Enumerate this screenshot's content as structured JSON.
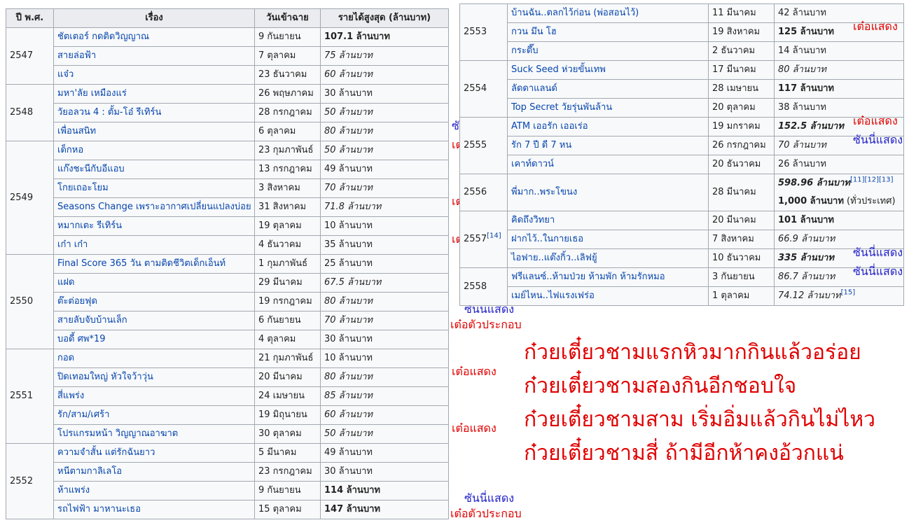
{
  "left_table": {
    "headers": [
      "ปี พ.ศ.",
      "เรื่อง",
      "วันเข้าฉาย",
      "รายได้สูงสุด (ล้านบาท)"
    ],
    "rows": [
      {
        "year": "2547",
        "title": "ชัตเตอร์ กดติดวิญญาณ",
        "date": "9 กันยายน",
        "gross": "107.1 ล้านบาท",
        "style": "big"
      },
      {
        "title": "สายล่อฟ้า",
        "date": "7 ตุลาคม",
        "gross": "75 ล้านบาท",
        "style": "inc"
      },
      {
        "title": "แจ๋ว",
        "date": "23 ธันวาคม",
        "gross": "60 ล้านบาท",
        "style": "inc"
      },
      {
        "year": "2548",
        "title": "มหา'ลัย เหมืองแร่",
        "date": "26 พฤษภาคม",
        "gross": "30 ล้านบาท",
        "style": ""
      },
      {
        "title": "วัยอลวน 4 : ตั้ม-โอ๋ รีเทิร์น",
        "date": "28 กรกฎาคม",
        "gross": "50 ล้านบาท",
        "style": "inc"
      },
      {
        "title": "เพื่อนสนิท",
        "date": "6 ตุลาคม",
        "gross": "80 ล้านบาท",
        "style": "inc",
        "note": "ซันนี่แสดง",
        "note_color": "blue"
      },
      {
        "year": "2549",
        "title": "เด็กหอ",
        "date": "23 กุมภาพันธ์",
        "gross": "50 ล้านบาท",
        "style": "inc",
        "note": "เต๋อตัวประกอบ",
        "note_color": "red"
      },
      {
        "title": "แก๊งชะนีกับอีแอบ",
        "date": "13 กรกฎาคม",
        "gross": "49 ล้านบาท",
        "style": ""
      },
      {
        "title": "โกยเถอะโยม",
        "date": "3 สิงหาคม",
        "gross": "70 ล้านบาท",
        "style": "inc"
      },
      {
        "title": "Seasons Change เพราะอากาศเปลี่ยนแปลงบ่อย",
        "date": "31 สิงหาคม",
        "gross": "71.8 ล้านบาท",
        "style": "inc",
        "note": "เต๋อตัวประกอบ",
        "note_color": "red"
      },
      {
        "title": "หมากเตะ รีเทิร์น",
        "date": "19 ตุลาคม",
        "gross": "10 ล้านบาท",
        "style": ""
      },
      {
        "title": "เก๋า เก๋า",
        "date": "4 ธันวาคม",
        "gross": "35 ล้านบาท",
        "style": "",
        "note": "เต๋อตัวประกอบ",
        "note_color": "red"
      },
      {
        "year": "2550",
        "title": "Final Score 365 วัน ตามติดชีวิตเด็กเอ็นท์",
        "date": "1 กุมภาพันธ์",
        "gross": "25 ล้านบาท",
        "style": ""
      },
      {
        "title": "แฝด",
        "date": "29 มีนาคม",
        "gross": "67.5 ล้านบาท",
        "style": "inc"
      },
      {
        "title": "ต๊ะต่อยฟุด",
        "date": "19 กรกฎาคม",
        "gross": "80 ล้านบาท",
        "style": "inc"
      },
      {
        "title": "สายลับจับบ้านเล็ก",
        "date": "6 กันยายน",
        "gross": "70 ล้านบาท",
        "style": "inc",
        "note": "ซันนี่แสดง",
        "note_color": "blue",
        "note2": "เต๋อตัวประกอบ",
        "note2_color": "red"
      },
      {
        "title": "บอดี้ ศพ*19",
        "date": "4 ตุลาคม",
        "gross": "30 ล้านบาท",
        "style": ""
      },
      {
        "year": "2551",
        "title": "กอด",
        "date": "21 กุมภาพันธ์",
        "gross": "10 ล้านบาท",
        "style": ""
      },
      {
        "title": "ปิดเทอมใหญ่ หัวใจว้าวุ่น",
        "date": "20 มีนาคม",
        "gross": "80 ล้านบาท",
        "style": "inc",
        "note": "เต๋อแสดง",
        "note_color": "red"
      },
      {
        "title": "สี่แพร่ง",
        "date": "24 เมษายน",
        "gross": "85 ล้านบาท",
        "style": "inc"
      },
      {
        "title": "รัก/สาม/เศร้า",
        "date": "19 มิถุนายน",
        "gross": "60 ล้านบาท",
        "style": "inc"
      },
      {
        "title": "โปรแกรมหน้า วิญญาณอาฆาต",
        "date": "30 ตุลาคม",
        "gross": "50 ล้านบาท",
        "style": "inc",
        "note": "เต๋อแสดง",
        "note_color": "red"
      },
      {
        "year": "2552",
        "title": "ความจำสั้น แต่รักฉันยาว",
        "date": "5 มีนาคม",
        "gross": "49 ล้านบาท",
        "style": ""
      },
      {
        "title": "หนีตามกาลิเลโอ",
        "date": "23 กรกฎาคม",
        "gross": "30 ล้านบาท",
        "style": ""
      },
      {
        "title": "ห้าแพร่ง",
        "date": "9 กันยายน",
        "gross": "114 ล้านบาท",
        "style": "big"
      },
      {
        "title": "รถไฟฟ้า มาหานะเธอ",
        "date": "15 ตุลาคม",
        "gross": "147 ล้านบาท",
        "style": "big",
        "note": "ซันนี่แสดง",
        "note_color": "blue",
        "note2": "เต๋อตัวประกอบ",
        "note2_color": "red"
      }
    ]
  },
  "right_table": {
    "rows": [
      {
        "year": "2553",
        "title": "บ้านฉัน..ตลกไว้ก่อน (พ่อสอนไว้)",
        "date": "11 มีนาคม",
        "gross": "42 ล้านบาท",
        "style": ""
      },
      {
        "title": "กวน มึน โฮ",
        "date": "19 สิงหาคม",
        "gross": "125 ล้านบาท",
        "style": "big",
        "note": "เต๋อแสดง",
        "note_color": "red"
      },
      {
        "title": "กระดึ๊บ",
        "date": "2 ธันวาคม",
        "gross": "14 ล้านบาท",
        "style": ""
      },
      {
        "year": "2554",
        "title": "Suck Seed ห่วยขั้นเทพ",
        "date": "17 มีนาคม",
        "gross": "80 ล้านบาท",
        "style": "inc"
      },
      {
        "title": "ลัดดาแลนด์",
        "date": "28 เมษายน",
        "gross": "117 ล้านบาท",
        "style": "big"
      },
      {
        "title": "Top Secret วัยรุ่นพันล้าน",
        "date": "20 ตุลาคม",
        "gross": "38 ล้านบาท",
        "style": ""
      },
      {
        "year": "2555",
        "title": "ATM เออรัก เออเร่อ",
        "date": "19 มกราคม",
        "gross": "152.5 ล้านบาท",
        "style": "bigi",
        "note": "เต๋อแสดง",
        "note_color": "red"
      },
      {
        "title": "รัก 7 ปี ดี 7 หน",
        "date": "26 กรกฎาคม",
        "gross": "70 ล้านบาท",
        "style": "inc",
        "note": "ซันนี่แสดง",
        "note_color": "blue"
      },
      {
        "title": "เคาท์ดาวน์",
        "date": "20 ธันวาคม",
        "gross": "26 ล้านบาท",
        "style": ""
      },
      {
        "year": "2556",
        "title": "พี่มาก..พระโขนง",
        "date": "28 มีนาคม",
        "gross": "598.96 ล้านบาท",
        "gross_refs": "[11][12][13]",
        "gross2": "1,000 ล้านบาท",
        "gross2_suffix": " (ทั่วประเทศ)",
        "style": "bigi"
      },
      {
        "year": "2557",
        "year_ref": "[14]",
        "title": "คิดถึงวิทยา",
        "date": "20 มีนาคม",
        "gross": "101 ล้านบาท",
        "style": "big"
      },
      {
        "title": "ฝากไว้..ในกายเธอ",
        "date": "7 สิงหาคม",
        "gross": "66.9 ล้านบาท",
        "style": "inc"
      },
      {
        "title": "ไอฟาย..แต๊งกิ้ว..เลิฟยู้",
        "date": "10 ธันวาคม",
        "gross": "335 ล้านบาท",
        "style": "bigi",
        "note": "ซันนี่แสดง",
        "note_color": "blue"
      },
      {
        "year": "2558",
        "title": "ฟรีแลนซ์..ห้ามป่วย ห้ามพัก ห้ามรักหมอ",
        "date": "3 กันยายน",
        "gross": "86.7 ล้านบาท",
        "style": "inc",
        "note": "ซันนี่แสดง",
        "note_color": "blue"
      },
      {
        "title": "เมย์ไหน..ไฟแรงเฟร่อ",
        "date": "1 ตุลาคม",
        "gross": "74.12 ล้านบาท",
        "gross_refs": "[15]",
        "style": "inc"
      }
    ]
  },
  "poem": [
    "ก๋วยเตี๋ยวชามแรกหิวมากกินแล้วอร่อย",
    "ก๋วยเตี๋ยวชามสองกินอีกชอบใจ",
    "ก๋วยเตี๋ยวชามสาม  เริ่มอิ่มแล้วกินไม่ไหว",
    "ก๋วยเตี๋ยวชามสี่  ถ้ามีอีกห้าคงอ้วกแน่"
  ]
}
